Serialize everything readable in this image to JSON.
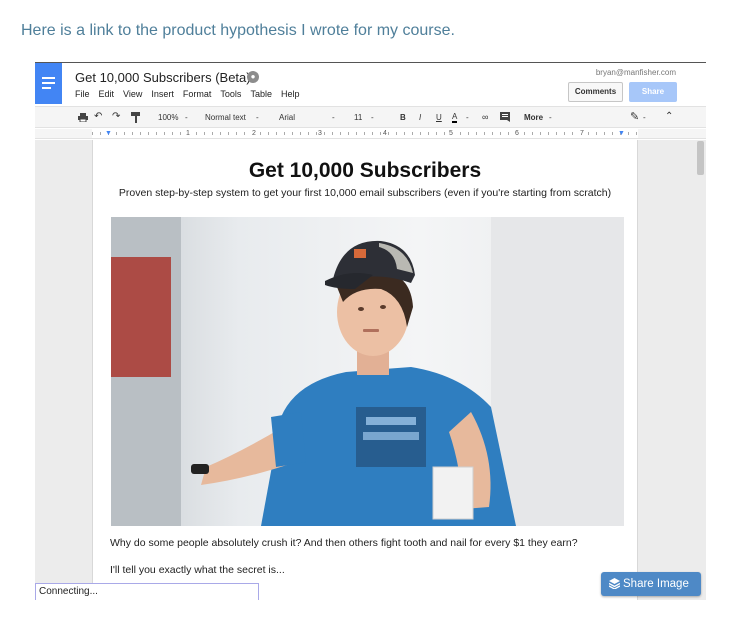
{
  "intro_text": "Here is a link to the product hypothesis I wrote for my course.",
  "docs": {
    "title": "Get 10,000 Subscribers (Beta)",
    "user_email": "bryan@manfisher.com",
    "comments_label": "Comments",
    "share_label": "Share",
    "menu": [
      "File",
      "Edit",
      "View",
      "Insert",
      "Format",
      "Tools",
      "Table",
      "Help"
    ],
    "toolbar": {
      "zoom": "100%",
      "style": "Normal text",
      "font": "Arial",
      "size": "11",
      "bold": "B",
      "italic": "I",
      "underline": "U",
      "text_color": "A",
      "more": "More"
    },
    "ruler_numbers": [
      "1",
      "2",
      "3",
      "4",
      "5",
      "6",
      "7"
    ]
  },
  "document": {
    "title": "Get 10,000 Subscribers",
    "subtitle": "Proven step-by-step system to get your first 10,000 email subscribers (even if you're starting from scratch)",
    "paragraph1": "Why do some people absolutely crush it? And then others fight tooth and nail for every $1 they earn?",
    "paragraph2": "I'll tell you exactly what the secret is..."
  },
  "status": {
    "connecting": "Connecting..."
  },
  "share_image_label": "Share Image",
  "colors": {
    "docs_blue": "#4285f4",
    "share_button": "#a7c7f9",
    "share_image_button": "#4e89c6",
    "intro_text": "#4f7f9a"
  }
}
